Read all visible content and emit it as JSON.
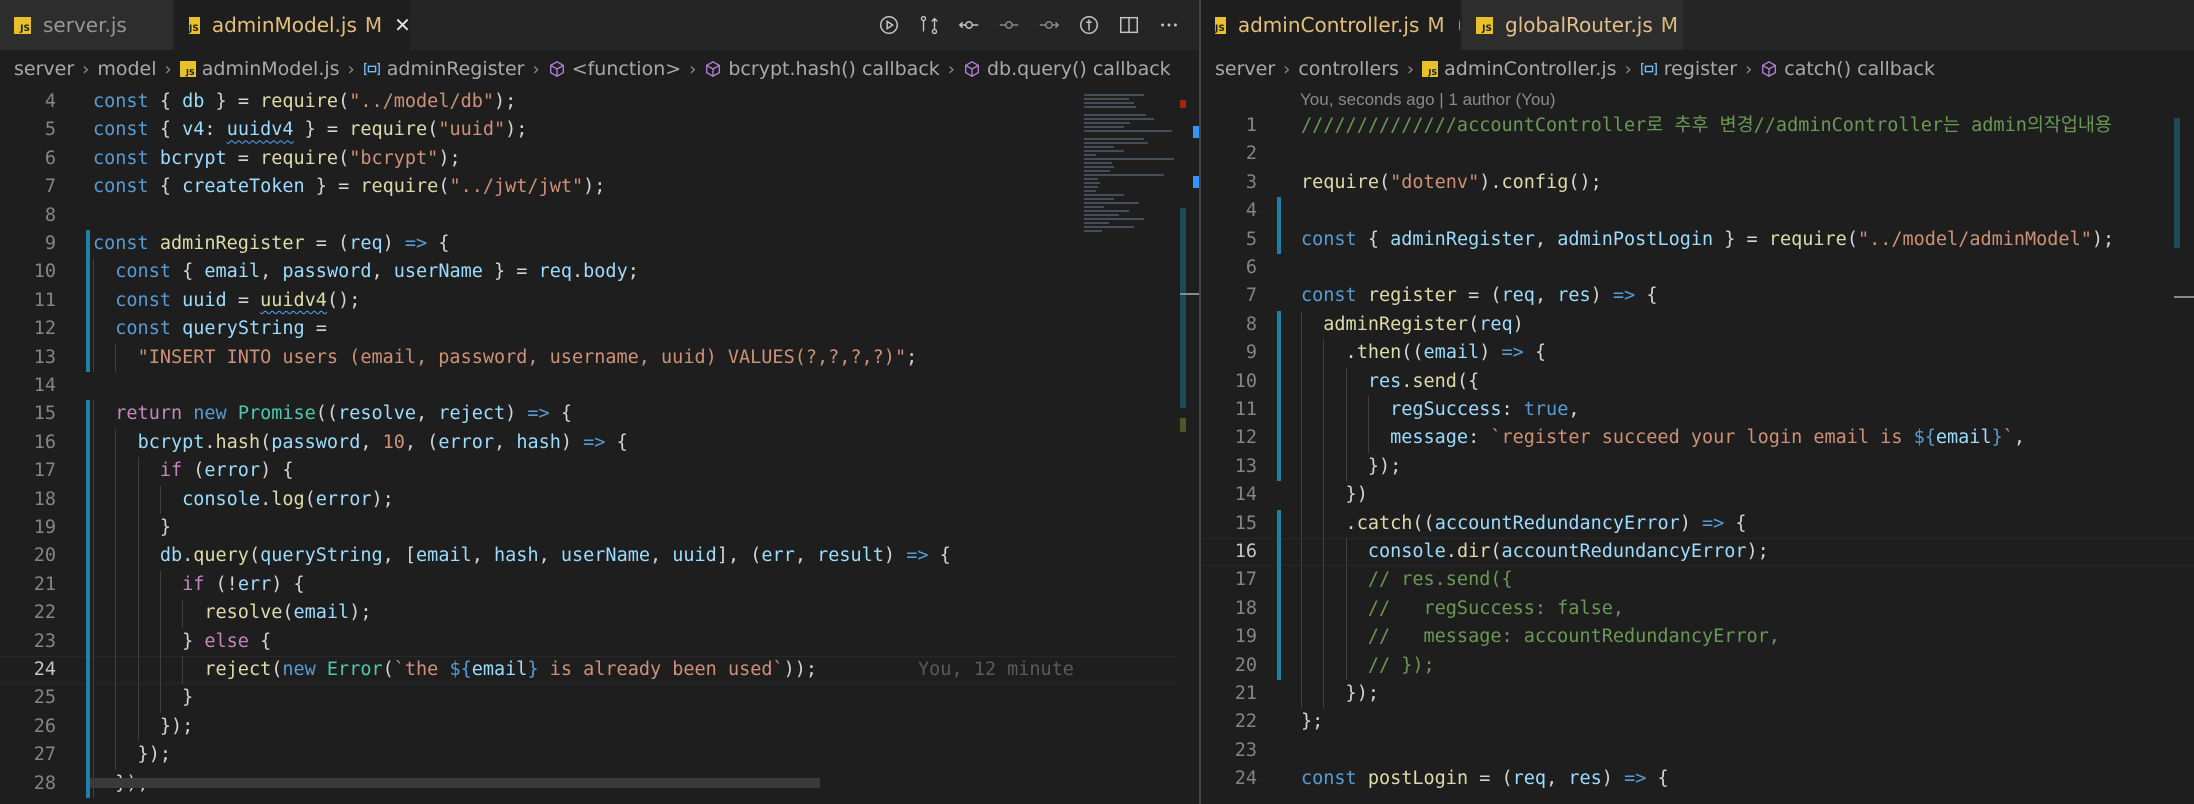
{
  "left": {
    "tabs": [
      {
        "label": "server.js",
        "modified": "",
        "active": false
      },
      {
        "label": "adminModel.js",
        "modified": "M",
        "active": true
      }
    ],
    "breadcrumb": [
      "server",
      "model",
      "adminModel.js",
      "adminRegister",
      "<function>",
      "bcrypt.hash() callback",
      "db.query() callback"
    ],
    "line_numbers": [
      "4",
      "5",
      "6",
      "7",
      "8",
      "9",
      "10",
      "11",
      "12",
      "13",
      "14",
      "15",
      "16",
      "17",
      "18",
      "19",
      "20",
      "21",
      "22",
      "23",
      "24",
      "25",
      "26",
      "27",
      "28"
    ],
    "inline_blame": "You, 12 minute"
  },
  "right": {
    "tabs": [
      {
        "label": "adminController.js",
        "modified": "M",
        "active": true,
        "unsaved": true
      },
      {
        "label": "globalRouter.js",
        "modified": "M",
        "active": false
      }
    ],
    "breadcrumb": [
      "server",
      "controllers",
      "adminController.js",
      "register",
      "catch() callback"
    ],
    "codelens": "You, seconds ago | 1 author (You)",
    "line_numbers": [
      "1",
      "2",
      "3",
      "4",
      "5",
      "6",
      "7",
      "8",
      "9",
      "10",
      "11",
      "12",
      "13",
      "14",
      "15",
      "16",
      "17",
      "18",
      "19",
      "20",
      "21",
      "22",
      "23",
      "24"
    ]
  },
  "toolbar_icons": [
    "run-icon",
    "git-compare-icon",
    "git-commit-icon",
    "previous-change-icon",
    "next-change-icon",
    "open-changes-icon",
    "split-editor-icon",
    "more-icon"
  ],
  "code_left": [
    [
      [
        "k",
        "const"
      ],
      [
        "p",
        " { "
      ],
      [
        "v",
        "db"
      ],
      [
        "p",
        " } = "
      ],
      [
        "f",
        "require"
      ],
      [
        "p",
        "("
      ],
      [
        "s",
        "\"../model/db\""
      ],
      [
        "p",
        ");"
      ]
    ],
    [
      [
        "k",
        "const"
      ],
      [
        "p",
        " { "
      ],
      [
        "v",
        "v4"
      ],
      [
        "p",
        ": "
      ],
      [
        "v squig",
        "uuidv4"
      ],
      [
        "p",
        " } = "
      ],
      [
        "f",
        "require"
      ],
      [
        "p",
        "("
      ],
      [
        "s",
        "\"uuid\""
      ],
      [
        "p",
        ");"
      ]
    ],
    [
      [
        "k",
        "const"
      ],
      [
        "p",
        " "
      ],
      [
        "v",
        "bcrypt"
      ],
      [
        "p",
        " = "
      ],
      [
        "f",
        "require"
      ],
      [
        "p",
        "("
      ],
      [
        "s",
        "\"bcrypt\""
      ],
      [
        "p",
        ");"
      ]
    ],
    [
      [
        "k",
        "const"
      ],
      [
        "p",
        " { "
      ],
      [
        "v",
        "createToken"
      ],
      [
        "p",
        " } = "
      ],
      [
        "f",
        "require"
      ],
      [
        "p",
        "("
      ],
      [
        "s",
        "\"../jwt/jwt\""
      ],
      [
        "p",
        ");"
      ]
    ],
    [],
    [
      [
        "k",
        "const"
      ],
      [
        "p",
        " "
      ],
      [
        "f",
        "adminRegister"
      ],
      [
        "p",
        " = ("
      ],
      [
        "v",
        "req"
      ],
      [
        "p",
        ") "
      ],
      [
        "k",
        "=>"
      ],
      [
        "p",
        " {"
      ]
    ],
    [
      [
        "p",
        "  "
      ],
      [
        "k",
        "const"
      ],
      [
        "p",
        " { "
      ],
      [
        "v",
        "email"
      ],
      [
        "p",
        ", "
      ],
      [
        "v",
        "password"
      ],
      [
        "p",
        ", "
      ],
      [
        "v",
        "userName"
      ],
      [
        "p",
        " } = "
      ],
      [
        "v",
        "req"
      ],
      [
        "p",
        "."
      ],
      [
        "v",
        "body"
      ],
      [
        "p",
        ";"
      ]
    ],
    [
      [
        "p",
        "  "
      ],
      [
        "k",
        "const"
      ],
      [
        "p",
        " "
      ],
      [
        "v",
        "uuid"
      ],
      [
        "p",
        " = "
      ],
      [
        "f squig",
        "uuidv4"
      ],
      [
        "p",
        "();"
      ]
    ],
    [
      [
        "p",
        "  "
      ],
      [
        "k",
        "const"
      ],
      [
        "p",
        " "
      ],
      [
        "v",
        "queryString"
      ],
      [
        "p",
        " ="
      ]
    ],
    [
      [
        "p",
        "    "
      ],
      [
        "s",
        "\"INSERT INTO users (email, password, username, uuid) VALUES(?,?,?,?)\""
      ],
      [
        "p",
        ";"
      ]
    ],
    [],
    [
      [
        "p",
        "  "
      ],
      [
        "kc",
        "return"
      ],
      [
        "p",
        " "
      ],
      [
        "k",
        "new"
      ],
      [
        "p",
        " "
      ],
      [
        "t",
        "Promise"
      ],
      [
        "p",
        "(("
      ],
      [
        "v",
        "resolve"
      ],
      [
        "p",
        ", "
      ],
      [
        "v",
        "reject"
      ],
      [
        "p",
        ") "
      ],
      [
        "k",
        "=>"
      ],
      [
        "p",
        " {"
      ]
    ],
    [
      [
        "p",
        "    "
      ],
      [
        "v",
        "bcrypt"
      ],
      [
        "p",
        "."
      ],
      [
        "f",
        "hash"
      ],
      [
        "p",
        "("
      ],
      [
        "v",
        "password"
      ],
      [
        "p",
        ", "
      ],
      [
        "s",
        "10"
      ],
      [
        "p",
        ", ("
      ],
      [
        "v",
        "error"
      ],
      [
        "p",
        ", "
      ],
      [
        "v",
        "hash"
      ],
      [
        "p",
        ") "
      ],
      [
        "k",
        "=>"
      ],
      [
        "p",
        " {"
      ]
    ],
    [
      [
        "p",
        "      "
      ],
      [
        "kc",
        "if"
      ],
      [
        "p",
        " ("
      ],
      [
        "v",
        "error"
      ],
      [
        "p",
        ") {"
      ]
    ],
    [
      [
        "p",
        "        "
      ],
      [
        "v",
        "console"
      ],
      [
        "p",
        "."
      ],
      [
        "f",
        "log"
      ],
      [
        "p",
        "("
      ],
      [
        "v",
        "error"
      ],
      [
        "p",
        ");"
      ]
    ],
    [
      [
        "p",
        "      }"
      ]
    ],
    [
      [
        "p",
        "      "
      ],
      [
        "v",
        "db"
      ],
      [
        "p",
        "."
      ],
      [
        "f",
        "query"
      ],
      [
        "p",
        "("
      ],
      [
        "v",
        "queryString"
      ],
      [
        "p",
        ", ["
      ],
      [
        "v",
        "email"
      ],
      [
        "p",
        ", "
      ],
      [
        "v",
        "hash"
      ],
      [
        "p",
        ", "
      ],
      [
        "v",
        "userName"
      ],
      [
        "p",
        ", "
      ],
      [
        "v",
        "uuid"
      ],
      [
        "p",
        "], ("
      ],
      [
        "v",
        "err"
      ],
      [
        "p",
        ", "
      ],
      [
        "v",
        "result"
      ],
      [
        "p",
        ") "
      ],
      [
        "k",
        "=>"
      ],
      [
        "p",
        " {"
      ]
    ],
    [
      [
        "p",
        "        "
      ],
      [
        "kc",
        "if"
      ],
      [
        "p",
        " (!"
      ],
      [
        "v",
        "err"
      ],
      [
        "p",
        ") {"
      ]
    ],
    [
      [
        "p",
        "          "
      ],
      [
        "f",
        "resolve"
      ],
      [
        "p",
        "("
      ],
      [
        "v",
        "email"
      ],
      [
        "p",
        ");"
      ]
    ],
    [
      [
        "p",
        "        } "
      ],
      [
        "kc",
        "else"
      ],
      [
        "p",
        " {"
      ]
    ],
    [
      [
        "p",
        "          "
      ],
      [
        "f",
        "reject"
      ],
      [
        "p",
        "("
      ],
      [
        "k",
        "new"
      ],
      [
        "p",
        " "
      ],
      [
        "t",
        "Error"
      ],
      [
        "p",
        "("
      ],
      [
        "s",
        "`the "
      ],
      [
        "k",
        "${"
      ],
      [
        "v",
        "email"
      ],
      [
        "k",
        "}"
      ],
      [
        "s",
        " is already been used`"
      ],
      [
        "p",
        "));"
      ]
    ],
    [
      [
        "p",
        "        }"
      ]
    ],
    [
      [
        "p",
        "      });"
      ]
    ],
    [
      [
        "p",
        "    });"
      ]
    ],
    [
      [
        "p",
        "  });"
      ]
    ]
  ],
  "code_right": [
    [
      [
        "cm",
        "//////////////accountController로 추후 변경//adminController는 admin의작업내용"
      ]
    ],
    [],
    [
      [
        "f",
        "require"
      ],
      [
        "p",
        "("
      ],
      [
        "s",
        "\"dotenv\""
      ],
      [
        "p",
        ")."
      ],
      [
        "f",
        "config"
      ],
      [
        "p",
        "();"
      ]
    ],
    [],
    [
      [
        "k",
        "const"
      ],
      [
        "p",
        " { "
      ],
      [
        "v",
        "adminRegister"
      ],
      [
        "p",
        ", "
      ],
      [
        "v",
        "adminPostLogin"
      ],
      [
        "p",
        " } = "
      ],
      [
        "f",
        "require"
      ],
      [
        "p",
        "("
      ],
      [
        "s",
        "\"../model/adminModel\""
      ],
      [
        "p",
        ");"
      ]
    ],
    [],
    [
      [
        "k",
        "const"
      ],
      [
        "p",
        " "
      ],
      [
        "f",
        "register"
      ],
      [
        "p",
        " = ("
      ],
      [
        "v",
        "req"
      ],
      [
        "p",
        ", "
      ],
      [
        "v",
        "res"
      ],
      [
        "p",
        ") "
      ],
      [
        "k",
        "=>"
      ],
      [
        "p",
        " {"
      ]
    ],
    [
      [
        "p",
        "  "
      ],
      [
        "f",
        "adminRegister"
      ],
      [
        "p",
        "("
      ],
      [
        "v",
        "req"
      ],
      [
        "p",
        ")"
      ]
    ],
    [
      [
        "p",
        "    ."
      ],
      [
        "f",
        "then"
      ],
      [
        "p",
        "(("
      ],
      [
        "v",
        "email"
      ],
      [
        "p",
        ") "
      ],
      [
        "k",
        "=>"
      ],
      [
        "p",
        " {"
      ]
    ],
    [
      [
        "p",
        "      "
      ],
      [
        "v",
        "res"
      ],
      [
        "p",
        "."
      ],
      [
        "f",
        "send"
      ],
      [
        "p",
        "({"
      ]
    ],
    [
      [
        "p",
        "        "
      ],
      [
        "v",
        "regSuccess"
      ],
      [
        "p",
        ": "
      ],
      [
        "k",
        "true"
      ],
      [
        "p",
        ","
      ]
    ],
    [
      [
        "p",
        "        "
      ],
      [
        "v",
        "message"
      ],
      [
        "p",
        ": "
      ],
      [
        "s",
        "`register succeed your login email is "
      ],
      [
        "k",
        "${"
      ],
      [
        "v",
        "email"
      ],
      [
        "k",
        "}"
      ],
      [
        "s",
        "`"
      ],
      [
        "p",
        ","
      ]
    ],
    [
      [
        "p",
        "      });"
      ]
    ],
    [
      [
        "p",
        "    })"
      ]
    ],
    [
      [
        "p",
        "    ."
      ],
      [
        "f",
        "catch"
      ],
      [
        "p",
        "(("
      ],
      [
        "v",
        "accountRedundancyError"
      ],
      [
        "p",
        ") "
      ],
      [
        "k",
        "=>"
      ],
      [
        "p",
        " {"
      ]
    ],
    [
      [
        "p",
        "      "
      ],
      [
        "v",
        "console"
      ],
      [
        "p",
        "."
      ],
      [
        "f",
        "dir"
      ],
      [
        "p",
        "("
      ],
      [
        "v",
        "accountRedundancyError"
      ],
      [
        "p",
        ");"
      ]
    ],
    [
      [
        "p",
        "      "
      ],
      [
        "cm",
        "// res.send({"
      ]
    ],
    [
      [
        "p",
        "      "
      ],
      [
        "cm",
        "//   regSuccess: false,"
      ]
    ],
    [
      [
        "p",
        "      "
      ],
      [
        "cm",
        "//   message: accountRedundancyError,"
      ]
    ],
    [
      [
        "p",
        "      "
      ],
      [
        "cm",
        "// });"
      ]
    ],
    [
      [
        "p",
        "    });"
      ]
    ],
    [
      [
        "p",
        "};"
      ]
    ],
    [],
    [
      [
        "k",
        "const"
      ],
      [
        "p",
        " "
      ],
      [
        "f",
        "postLogin"
      ],
      [
        "p",
        " = ("
      ],
      [
        "v",
        "req"
      ],
      [
        "p",
        ", "
      ],
      [
        "v",
        "res"
      ],
      [
        "p",
        ") "
      ],
      [
        "k",
        "=>"
      ],
      [
        "p",
        " {"
      ]
    ]
  ]
}
